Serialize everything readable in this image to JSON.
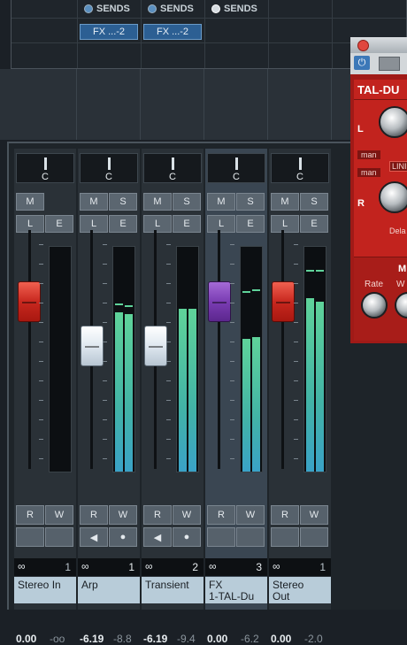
{
  "sends": {
    "headers": [
      "SENDS",
      "SENDS",
      "SENDS"
    ],
    "slots": [
      "FX ...-2",
      "FX ...-2"
    ]
  },
  "plugin": {
    "title": "TAL-DU",
    "labels": {
      "l": "L",
      "r": "R",
      "man1": "man",
      "man2": "man",
      "lin": "LINI",
      "delay": "Dela",
      "mod": "M",
      "rate": "Rate",
      "w": "W"
    },
    "colors": {
      "body": "#c2231e"
    }
  },
  "channels": [
    {
      "pan": "C",
      "mute": "M",
      "listen": "L",
      "edit": "E",
      "solo": "",
      "volume": "0.00",
      "peak": "-oo",
      "read": "R",
      "write": "W",
      "output_index": "1",
      "name": "Stereo In",
      "fader_color": "#c8281f",
      "meter_level": 0.0
    },
    {
      "pan": "C",
      "mute": "M",
      "listen": "L",
      "edit": "E",
      "solo": "S",
      "volume": "-6.19",
      "peak": "-8.8",
      "read": "R",
      "write": "W",
      "output_index": "1",
      "name": "Arp",
      "fader_color": "#dfe8f0",
      "meter_level": 0.72
    },
    {
      "pan": "C",
      "mute": "M",
      "listen": "L",
      "edit": "E",
      "solo": "S",
      "volume": "-6.19",
      "peak": "-9.4",
      "read": "R",
      "write": "W",
      "output_index": "2",
      "name": "Transient",
      "fader_color": "#dfe8f0",
      "meter_level": 0.72
    },
    {
      "pan": "C",
      "mute": "M",
      "listen": "L",
      "edit": "E",
      "solo": "S",
      "volume": "0.00",
      "peak": "-6.2",
      "read": "R",
      "write": "W",
      "output_index": "3",
      "name": "FX\n1-TAL-Du",
      "fader_color": "#7a3db3",
      "meter_level": 0.6
    },
    {
      "pan": "C",
      "mute": "M",
      "listen": "L",
      "edit": "E",
      "solo": "S",
      "volume": "0.00",
      "peak": "-2.0",
      "read": "R",
      "write": "W",
      "output_index": "1",
      "name": "Stereo\nOut",
      "fader_color": "#c8281f",
      "meter_level": 0.78
    }
  ]
}
